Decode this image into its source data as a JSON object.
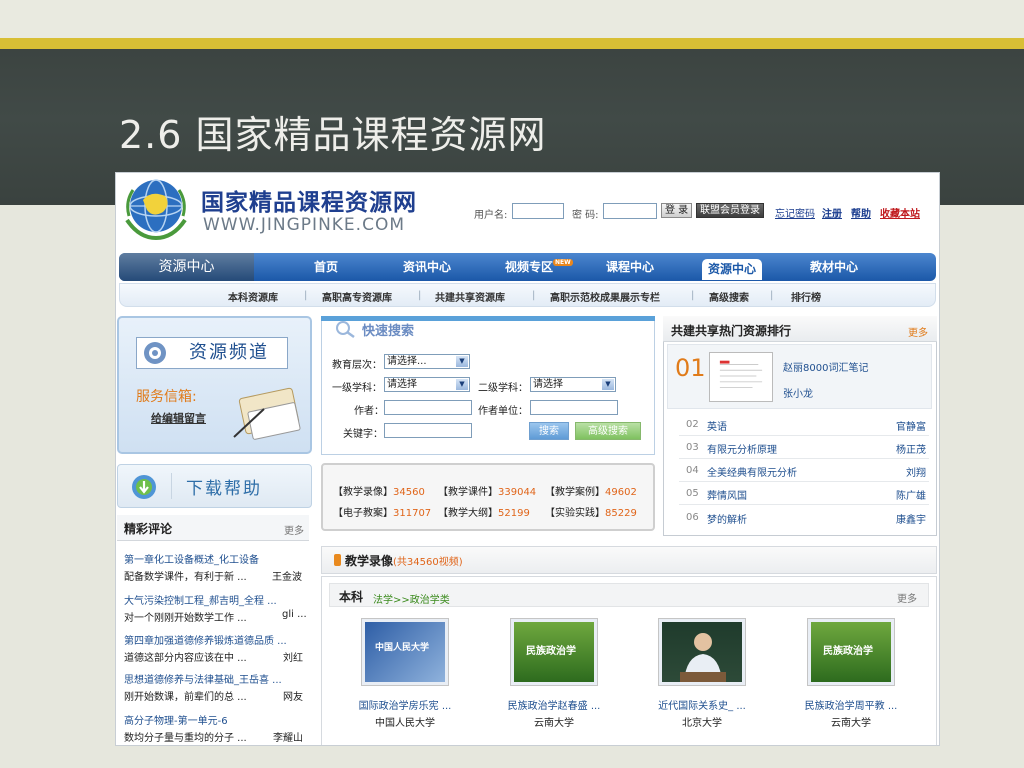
{
  "slide": {
    "title": "2.6 国家精品课程资源网"
  },
  "header": {
    "logo_cn": "国家精品课程资源网",
    "logo_en": "WWW.JINGPINKE.COM",
    "username_label": "用户名:",
    "password_label": "密 码:",
    "login_button": "登 录",
    "alliance_login_button": "联盟会员登录",
    "links": [
      "忘记密码",
      "注册",
      "帮助",
      "收藏本站"
    ]
  },
  "nav": {
    "resource_center": "资源中心",
    "items": [
      "首页",
      "资讯中心",
      "视频专区",
      "课程中心",
      "资源中心",
      "教材中心"
    ],
    "new_badge": "NEW",
    "active_index": 4
  },
  "subnav": {
    "items": [
      "本科资源库",
      "高职高专资源库",
      "共建共享资源库",
      "高职示范校成果展示专栏",
      "高级搜索",
      "排行榜"
    ]
  },
  "left": {
    "channel_label": "资源频道",
    "service_label": "服务信箱:",
    "service_link": "给编辑留言",
    "download_label": "下载帮助",
    "reviews_title": "精彩评论",
    "reviews_more": "更多",
    "reviews": [
      {
        "title": "第一章化工设备概述_化工设备",
        "snippet": "配备数学课件，有利于新 ...",
        "author": "王金波"
      },
      {
        "title": "大气污染控制工程_郝吉明_全程 ...",
        "snippet": "对一个刚刚开始数学工作 ...",
        "author": "gli ..."
      },
      {
        "title": "第四章加强道德修养锻炼道德品质 ...",
        "snippet": "道德这部分内容应该在中 ...",
        "author": "刘红"
      },
      {
        "title": "思想道德修养与法律基础_王岳喜 ...",
        "snippet": "刚开始数课，前辈们的总 ...",
        "author": "网友"
      },
      {
        "title": "高分子物理-第一单元-6",
        "snippet": "数均分子量与重均的分子 ...",
        "author": "李耀山"
      }
    ]
  },
  "search": {
    "title": "快速搜索",
    "level_label": "教育层次：",
    "level_value": "请选择...",
    "subject1_label": "一级学科：",
    "subject1_value": "请选择",
    "subject2_label": "二级学科：",
    "subject2_value": "请选择",
    "author_label": "作者：",
    "unit_label": "作者单位：",
    "keyword_label": "关键字：",
    "search_button": "搜索",
    "advanced_button": "高级搜索"
  },
  "stats": [
    {
      "label": "【教学录像】",
      "value": "34560"
    },
    {
      "label": "【教学课件】",
      "value": "339044"
    },
    {
      "label": "【教学案例】",
      "value": "49602"
    },
    {
      "label": "【电子教案】",
      "value": "311707"
    },
    {
      "label": "【教学大纲】",
      "value": "52199"
    },
    {
      "label": "【实验实践】",
      "value": "85229"
    }
  ],
  "ranking": {
    "title": "共建共享热门资源排行",
    "more": "更多",
    "featured": {
      "num": "01",
      "title": "赵丽8000词汇笔记",
      "author": "张小龙"
    },
    "items": [
      {
        "num": "02",
        "title": "英语",
        "author": "官静富"
      },
      {
        "num": "03",
        "title": "有限元分析原理",
        "author": "杨正茂"
      },
      {
        "num": "04",
        "title": "全美经典有限元分析",
        "author": "刘翔"
      },
      {
        "num": "05",
        "title": "葬情风国",
        "author": "陈广雄"
      },
      {
        "num": "06",
        "title": "梦的解析",
        "author": "康鑫宇"
      }
    ]
  },
  "videos": {
    "title": "教学录像",
    "count": "(共34560视频)",
    "category": "本科",
    "path": "法学>>政治学类",
    "more": "更多",
    "items": [
      {
        "title": "国际政治学房乐宪 ...",
        "school": "中国人民大学",
        "thumb_text": "中国人民大学"
      },
      {
        "title": "民族政治学赵春盛 ...",
        "school": "云南大学",
        "thumb_text": "民族政治学"
      },
      {
        "title": "近代国际关系史_ ...",
        "school": "北京大学",
        "thumb_text": ""
      },
      {
        "title": "民族政治学周平教 ...",
        "school": "云南大学",
        "thumb_text": "民族政治学"
      }
    ]
  }
}
